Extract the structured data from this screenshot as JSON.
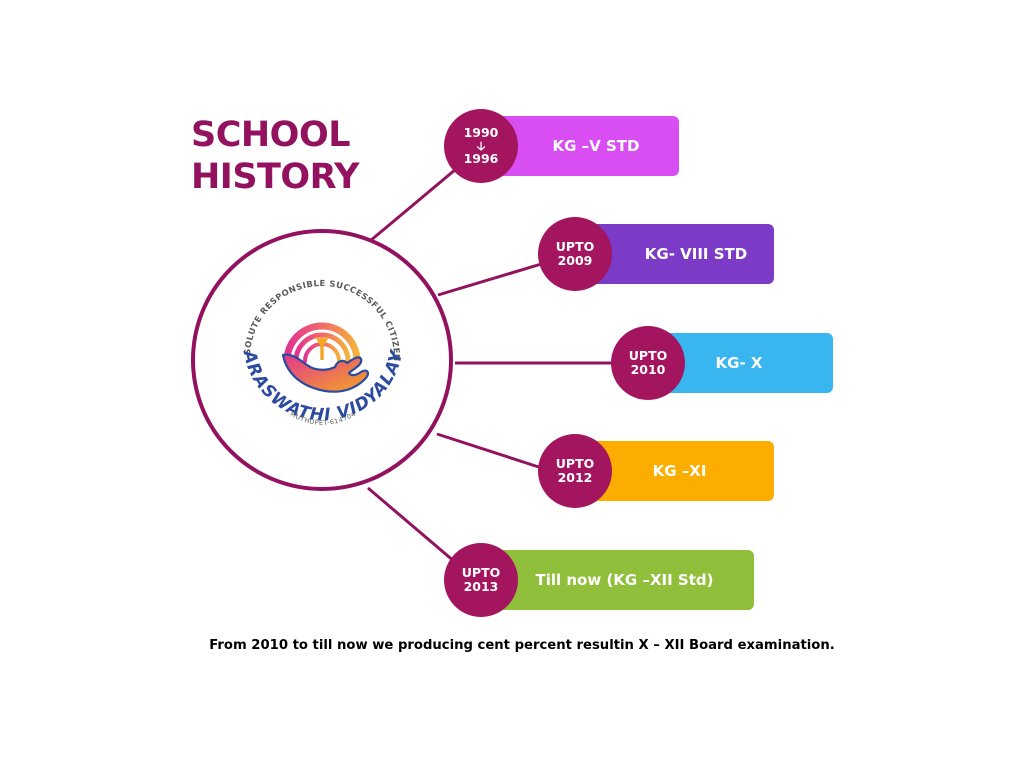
{
  "title": {
    "line1": "SCHOOL",
    "line2": "HISTORY"
  },
  "logo": {
    "arc_text": "RESOLUTE RESPONSIBLE SUCCESSFUL CITIZENS",
    "name": "SARASWATHI VIDYALAYA",
    "place": "MUTHUPET-614704"
  },
  "milestones": [
    {
      "badge_top": "1990",
      "badge_arrow": "🡣",
      "badge_bottom": "1996",
      "label": "KG –V STD",
      "color": "#d84ef2"
    },
    {
      "badge_top": "UPTO",
      "badge_bottom": "2009",
      "label": "KG- VIII STD",
      "color": "#7b3bc6"
    },
    {
      "badge_top": "UPTO",
      "badge_bottom": "2010",
      "label": "KG- X",
      "color": "#39b5f0"
    },
    {
      "badge_top": "UPTO",
      "badge_bottom": "2012",
      "label": "KG –XI",
      "color": "#fdad00"
    },
    {
      "badge_top": "UPTO",
      "badge_bottom": "2013",
      "label": "Till now (KG –XII Std)",
      "color": "#90c03b"
    }
  ],
  "footer": "From 2010 to till now we producing cent percent resultin X – XII Board examination.",
  "colors": {
    "accent": "#93125f",
    "badge": "#a3155f"
  }
}
